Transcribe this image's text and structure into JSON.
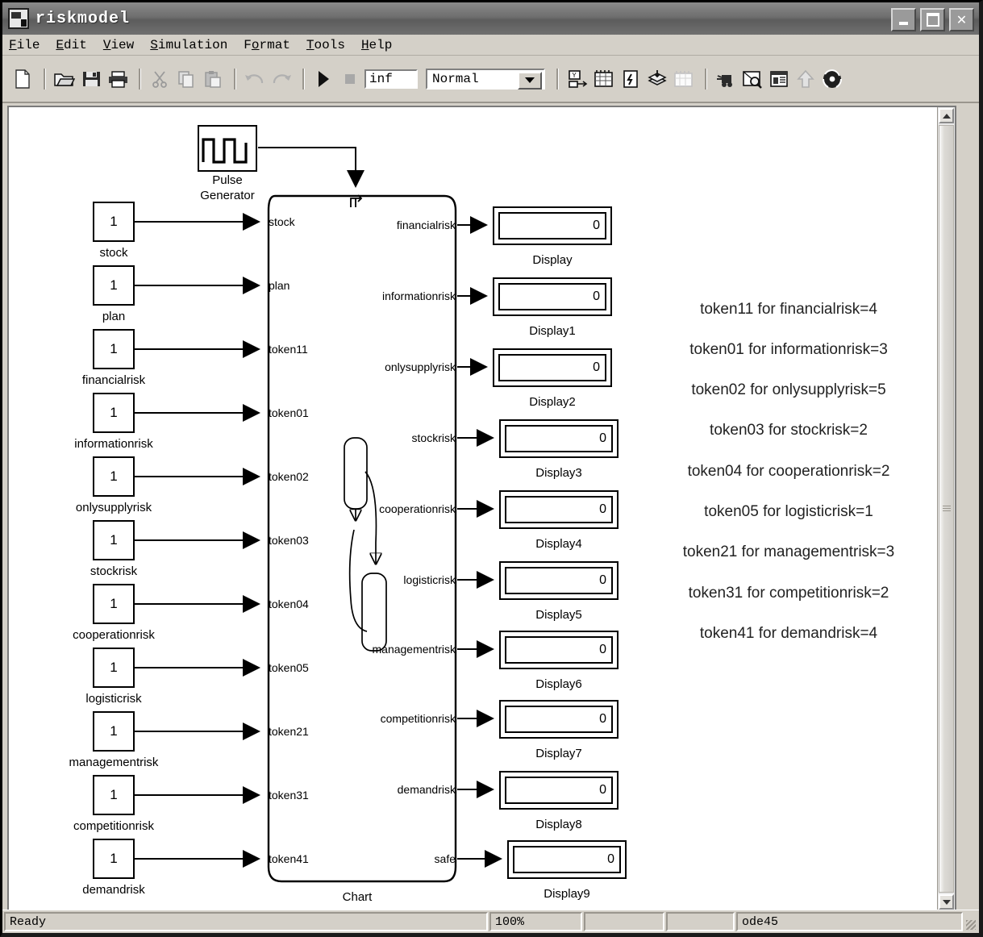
{
  "window": {
    "title": "riskmodel",
    "icon": "simulink-model-icon",
    "controls": [
      {
        "name": "minimize-button",
        "glyph": "_"
      },
      {
        "name": "maximize-button",
        "glyph": "□"
      },
      {
        "name": "close-button",
        "glyph": "✕"
      }
    ]
  },
  "menubar": [
    {
      "label": "File",
      "mnemonic": "F"
    },
    {
      "label": "Edit",
      "mnemonic": "E"
    },
    {
      "label": "View",
      "mnemonic": "V"
    },
    {
      "label": "Simulation",
      "mnemonic": "S"
    },
    {
      "label": "Format",
      "mnemonic": "o"
    },
    {
      "label": "Tools",
      "mnemonic": "T"
    },
    {
      "label": "Help",
      "mnemonic": "H"
    }
  ],
  "toolbar": {
    "stop_time": "inf",
    "sim_mode": "Normal",
    "buttons": [
      "new-model-icon",
      "open-model-icon",
      "save-icon",
      "print-icon",
      "cut-icon",
      "copy-icon",
      "paste-icon",
      "undo-icon",
      "redo-icon",
      "start-simulation-icon",
      "stop-simulation-icon",
      "library-browser-icon",
      "model-explorer-icon",
      "update-diagram-icon",
      "toggle-scope-icon",
      "data-inspector-icon",
      "debug-icon",
      "find-icon",
      "model-properties-icon",
      "go-up-icon",
      "web-icon"
    ]
  },
  "canvas": {
    "pulse_generator": {
      "label": "Pulse\nGenerator",
      "label_line1": "Pulse",
      "label_line2": "Generator",
      "icon": "square-wave-icon"
    },
    "chart": {
      "label": "Chart",
      "trigger_icon": "rising-edge-trigger-icon"
    },
    "constants": [
      {
        "name": "stock",
        "value": "1",
        "port": "stock"
      },
      {
        "name": "plan",
        "value": "1",
        "port": "plan"
      },
      {
        "name": "financialrisk",
        "value": "1",
        "port": "token11"
      },
      {
        "name": "informationrisk",
        "value": "1",
        "port": "token01"
      },
      {
        "name": "onlysupplyrisk",
        "value": "1",
        "port": "token02"
      },
      {
        "name": "stockrisk",
        "value": "1",
        "port": "token03"
      },
      {
        "name": "cooperationrisk",
        "value": "1",
        "port": "token04"
      },
      {
        "name": "logisticrisk",
        "value": "1",
        "port": "token05"
      },
      {
        "name": "managementrisk",
        "value": "1",
        "port": "token21"
      },
      {
        "name": "competitionrisk",
        "value": "1",
        "port": "token31"
      },
      {
        "name": "demandrisk",
        "value": "1",
        "port": "token41"
      }
    ],
    "displays": [
      {
        "port": "financialrisk",
        "name": "Display",
        "value": "0"
      },
      {
        "port": "informationrisk",
        "name": "Display1",
        "value": "0"
      },
      {
        "port": "onlysupplyrisk",
        "name": "Display2",
        "value": "0"
      },
      {
        "port": "stockrisk",
        "name": "Display3",
        "value": "0"
      },
      {
        "port": "cooperationrisk",
        "name": "Display4",
        "value": "0"
      },
      {
        "port": "logisticrisk",
        "name": "Display5",
        "value": "0"
      },
      {
        "port": "managementrisk",
        "name": "Display6",
        "value": "0"
      },
      {
        "port": "competitionrisk",
        "name": "Display7",
        "value": "0"
      },
      {
        "port": "demandrisk",
        "name": "Display8",
        "value": "0"
      },
      {
        "port": "safe",
        "name": "Display9",
        "value": "0"
      }
    ],
    "annotations": [
      "token11 for financialrisk=4",
      "token01 for informationrisk=3",
      "token02 for onlysupplyrisk=5",
      "token03 for stockrisk=2",
      "token04 for cooperationrisk=2",
      "token05 for logisticrisk=1",
      "token21 for managementrisk=3",
      "token31 for competitionrisk=2",
      "token41 for demandrisk=4"
    ]
  },
  "statusbar": {
    "message": "Ready",
    "zoom": "100%",
    "pane3": "",
    "pane4": "",
    "solver": "ode45"
  }
}
